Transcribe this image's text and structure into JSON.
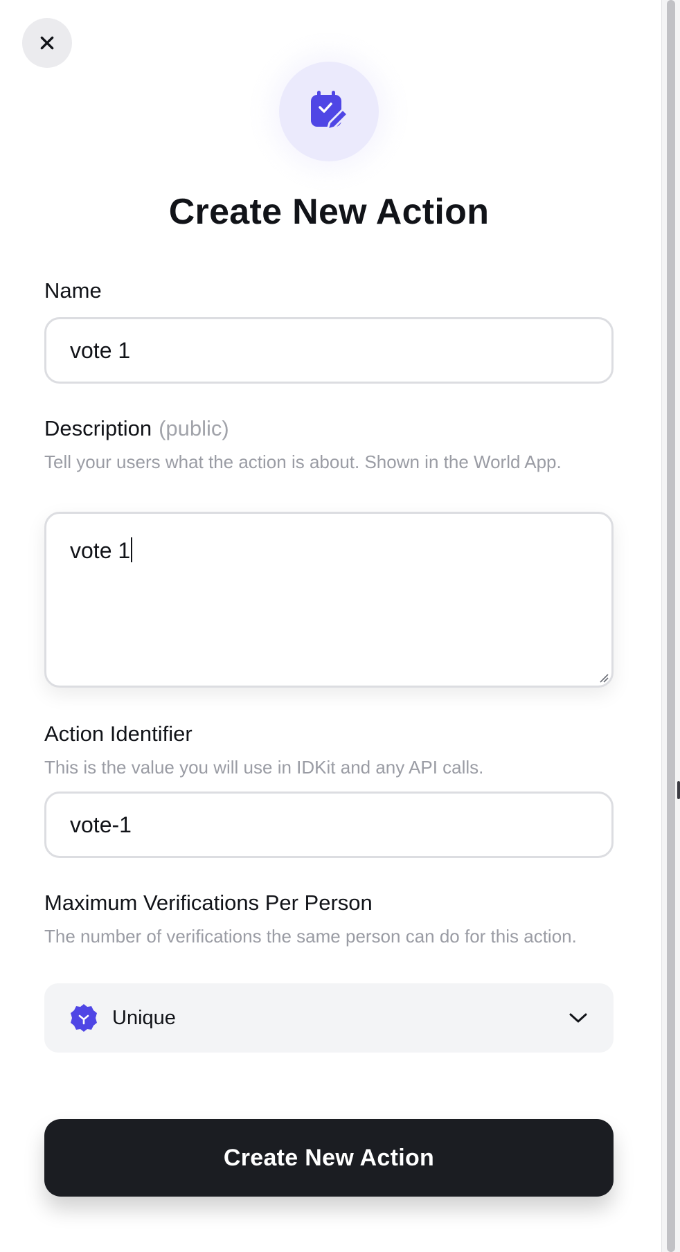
{
  "dialog": {
    "close_icon": "close-icon",
    "hero_icon": "calendar-edit-icon",
    "title": "Create New Action",
    "accent_color": "#4f46e5"
  },
  "form": {
    "name": {
      "label": "Name",
      "value": "vote 1"
    },
    "description": {
      "label": "Description",
      "tag": "(public)",
      "hint": "Tell your users what the action is about. Shown in the World App.",
      "value": "vote 1"
    },
    "identifier": {
      "label": "Action Identifier",
      "hint": "This is the value you will use in IDKit and any API calls.",
      "value": "vote-1"
    },
    "max_verifications": {
      "label": "Maximum Verifications Per Person",
      "hint": "The number of verifications the same person can do for this action.",
      "selected": "Unique",
      "selected_icon": "unique-badge-icon",
      "dropdown_icon": "chevron-down-icon"
    }
  },
  "submit": {
    "label": "Create New Action"
  }
}
